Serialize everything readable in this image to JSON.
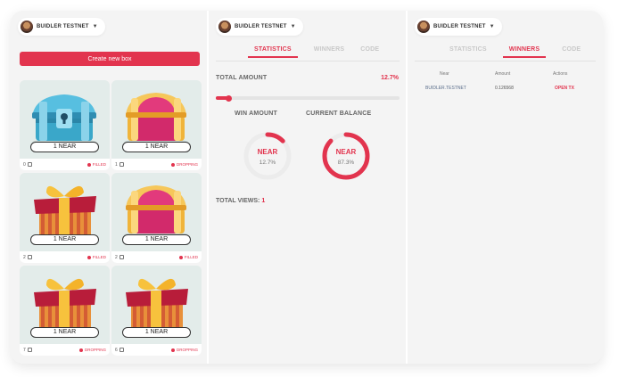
{
  "colors": {
    "accent": "#e2344e",
    "panel": "#f4f4f4"
  },
  "account": {
    "name": "BUIDLER TESTNET",
    "caret": "▼"
  },
  "left": {
    "create_label": "Create new box",
    "cards": [
      {
        "price": "1 NEAR",
        "count": "0",
        "status": "FILLED",
        "image": "blue-chest-icon"
      },
      {
        "price": "1 NEAR",
        "count": "1",
        "status": "DROPPING",
        "image": "gold-chest-icon"
      },
      {
        "price": "1 NEAR",
        "count": "2",
        "status": "FILLED",
        "image": "gift-box-icon"
      },
      {
        "price": "1 NEAR",
        "count": "2",
        "status": "FILLED",
        "image": "gold-chest-icon"
      },
      {
        "price": "1 NEAR",
        "count": "7",
        "status": "DROPPING",
        "image": "gift-box-icon"
      },
      {
        "price": "1 NEAR",
        "count": "6",
        "status": "DROPPING",
        "image": "gift-box-icon"
      }
    ]
  },
  "stats": {
    "tabs": [
      "STATISTICS",
      "WINNERS",
      "CODE"
    ],
    "active_tab": "STATISTICS",
    "total_amount_label": "TOTAL AMOUNT",
    "total_amount_percent": "12.7%",
    "total_amount_fraction": 0.127,
    "win_amount_label": "WIN AMOUNT",
    "current_balance_label": "CURRENT BALANCE",
    "win_ring": {
      "unit": "NEAR",
      "percent": "12.7%",
      "fraction": 0.127
    },
    "balance_ring": {
      "unit": "NEAR",
      "percent": "87.3%",
      "fraction": 0.873
    },
    "total_views_label": "TOTAL VIEWS:",
    "total_views": "1"
  },
  "winners": {
    "tabs": [
      "STATISTICS",
      "WINNERS",
      "CODE"
    ],
    "active_tab": "WINNERS",
    "columns": [
      "Near",
      "Amount",
      "Actions"
    ],
    "rows": [
      {
        "near": "BUIDLER.TESTNET",
        "amount": "0.126568",
        "action": "OPEN TX"
      }
    ]
  }
}
